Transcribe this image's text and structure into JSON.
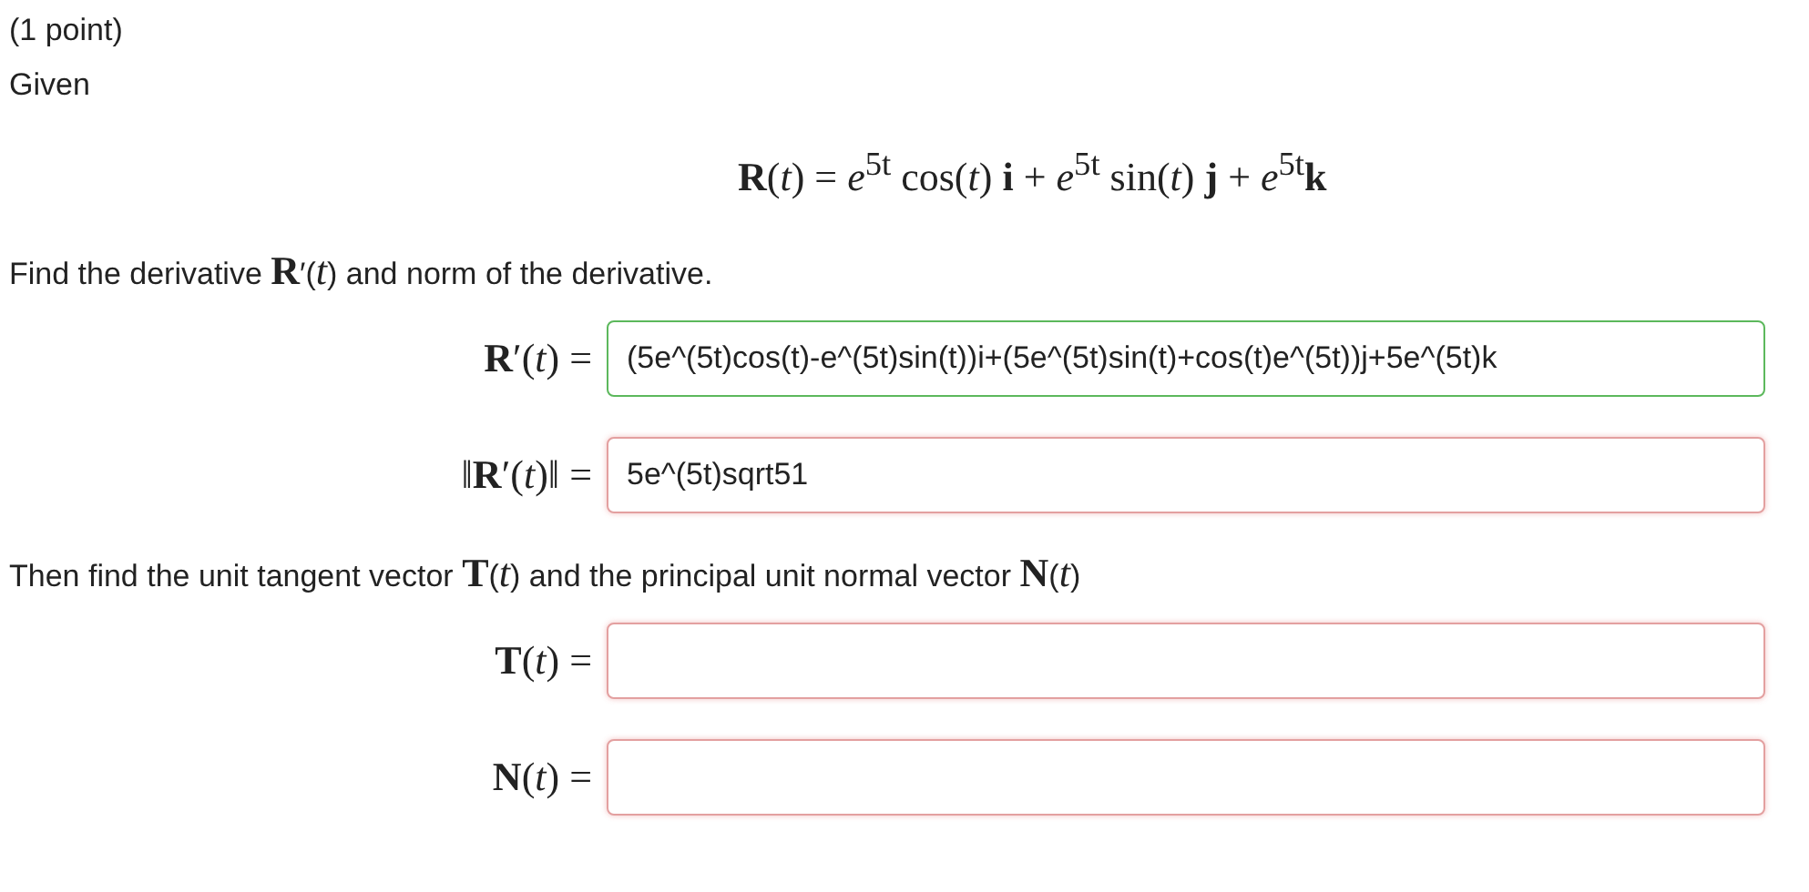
{
  "points": "(1 point)",
  "given": "Given",
  "equation": "**R**(*t*) = *e*$^{5t}$ cos(*t*) **i** + *e*$^{5t}$ sin(*t*) **j** + *e*$^{5t}$**k**",
  "instruction_1": "Find the derivative **R**′(*t*) and norm of the derivative.",
  "answers_1": [
    {
      "label": "**R**′(*t*) =",
      "value": "(5e^(5t)cos(t)-e^(5t)sin(t))i+(5e^(5t)sin(t)+cos(t)e^(5t))j+5e^(5t)k",
      "correct": true
    },
    {
      "label": "‖**R**′(*t*)‖ =",
      "value": "5e^(5t)sqrt51",
      "correct": false
    }
  ],
  "instruction_2": "Then find the unit tangent vector **T**(*t*) and the principal unit normal vector **N**(*t*)",
  "answers_2": [
    {
      "label": "**T**(*t*) =",
      "correct": false
    },
    {
      "label": "**N**(*t*) =",
      "correct": false
    }
  ]
}
